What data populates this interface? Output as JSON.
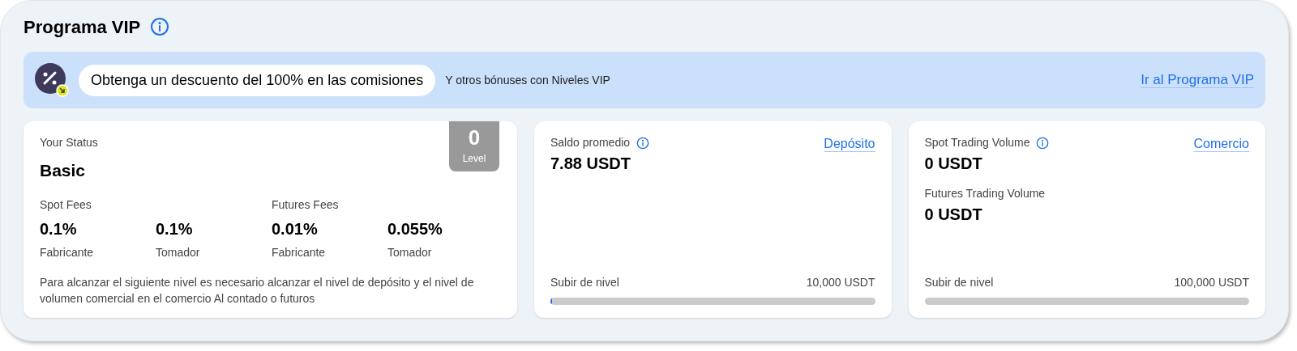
{
  "title": "Programa VIP",
  "banner": {
    "headline": "Obtenga un descuento del 100% en las comisiones",
    "subtext": "Y otros bónuses con Niveles VIP",
    "link": "Ir al Programa VIP"
  },
  "status_card": {
    "label": "Your Status",
    "status": "Basic",
    "level_badge": {
      "value": "0",
      "label": "Level"
    },
    "fee_groups": [
      {
        "title": "Spot Fees",
        "fees": [
          {
            "value": "0.1%",
            "label": "Fabricante"
          },
          {
            "value": "0.1%",
            "label": "Tomador"
          }
        ]
      },
      {
        "title": "Futures Fees",
        "fees": [
          {
            "value": "0.01%",
            "label": "Fabricante"
          },
          {
            "value": "0.055%",
            "label": "Tomador"
          }
        ]
      }
    ],
    "note": "Para alcanzar el siguiente nivel es necesario alcanzar el nivel de depósito y el nivel de volumen comercial en el comercio Al contado o futuros"
  },
  "metric_cards": [
    {
      "metrics": [
        {
          "label": "Saldo promedio",
          "info": true,
          "value": "7.88 USDT"
        }
      ],
      "link": "Depósito",
      "progress": {
        "label": "Subir de nivel",
        "target": "10,000 USDT",
        "level": 0.005
      }
    },
    {
      "metrics": [
        {
          "label": "Spot Trading Volume",
          "info": true,
          "value": "0 USDT"
        },
        {
          "label": "Futures Trading Volume",
          "info": false,
          "value": "0 USDT"
        }
      ],
      "link": "Comercio",
      "progress": {
        "label": "Subir de nivel",
        "target": "100,000 USDT"
      }
    }
  ]
}
